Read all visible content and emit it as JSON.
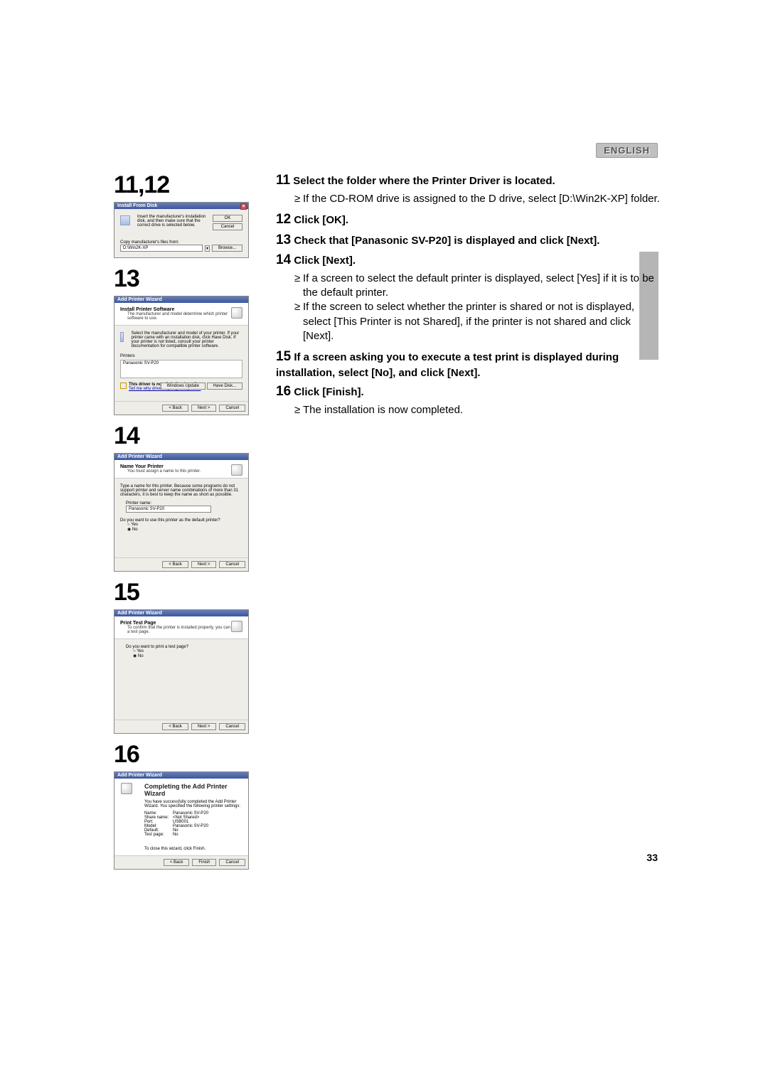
{
  "language_label": "ENGLISH",
  "page_number": "33",
  "left": {
    "heading_11_12": "11,12",
    "dlg_install_from_disk": {
      "title": "Install From Disk",
      "instruction": "Insert the manufacturer's installation disk, and then make sure that the correct drive is selected below.",
      "copy_label": "Copy manufacturer's files from:",
      "path_value": "D:\\Win2K-XP",
      "ok": "OK",
      "cancel": "Cancel",
      "browse": "Browse..."
    },
    "heading_13": "13",
    "dlg13": {
      "title": "Add Printer Wizard",
      "hdr_title": "Install Printer Software",
      "hdr_sub": "The manufacturer and model determine which printer software to use.",
      "body_text": "Select the manufacturer and model of your printer. If your printer came with an installation disk, click Have Disk. If your printer is not listed, consult your printer documentation for compatible printer software.",
      "printers_label": "Printers",
      "printer_item": "Panasonic SV-P20",
      "warn_bold": "This driver is not digitally signed!",
      "warn_link": "Tell me why driver signing is important",
      "win_update": "Windows Update",
      "have_disk": "Have Disk...",
      "back": "< Back",
      "next": "Next >",
      "cancel": "Cancel"
    },
    "heading_14": "14",
    "dlg14": {
      "title": "Add Printer Wizard",
      "hdr_title": "Name Your Printer",
      "hdr_sub": "You must assign a name to this printer.",
      "body_text": "Type a name for this printer. Because some programs do not support printer and server name combinations of more than 31 characters, it is best to keep the name as short as possible.",
      "name_label": "Printer name:",
      "name_value": "Panasonic SV-P20",
      "default_q": "Do you want to use this printer as the default printer?",
      "yes": "Yes",
      "no": "No",
      "back": "< Back",
      "next": "Next >",
      "cancel": "Cancel"
    },
    "heading_15": "15",
    "dlg15": {
      "title": "Add Printer Wizard",
      "hdr_title": "Print Test Page",
      "hdr_sub": "To confirm that the printer is installed properly, you can print a test page.",
      "q": "Do you want to print a test page?",
      "yes": "Yes",
      "no": "No",
      "back": "< Back",
      "next": "Next >",
      "cancel": "Cancel"
    },
    "heading_16": "16",
    "dlg16": {
      "title": "Add Printer Wizard",
      "complete_title": "Completing the Add Printer Wizard",
      "complete_sub": "You have successfully completed the Add Printer Wizard. You specified the following printer settings:",
      "kv": {
        "name_k": "Name:",
        "name_v": "Panasonic SV-P20",
        "share_k": "Share name:",
        "share_v": "<Not Shared>",
        "port_k": "Port:",
        "port_v": "USB001",
        "model_k": "Model:",
        "model_v": "Panasonic SV-P20",
        "default_k": "Default:",
        "default_v": "No",
        "test_k": "Test page:",
        "test_v": "No"
      },
      "close_hint": "To close this wizard, click Finish.",
      "back": "< Back",
      "finish": "Finish",
      "cancel": "Cancel"
    }
  },
  "steps": {
    "s11_num": "11",
    "s11_text": "Select the folder where the Printer Driver is located.",
    "s11_bullet": "If the CD-ROM drive is assigned to the D drive, select [D:\\Win2K-XP] folder.",
    "s12_num": "12",
    "s12_text": "Click [OK].",
    "s13_num": "13",
    "s13_text": "Check that [Panasonic SV-P20] is displayed and click [Next].",
    "s14_num": "14",
    "s14_text": "Click [Next].",
    "s14_bullet1": "If a screen to select the default printer is displayed, select [Yes] if it is to be the default printer.",
    "s14_bullet2": "If the screen to select whether the printer is shared or not is displayed, select [This Printer is not Shared], if the printer is not shared and click [Next].",
    "s15_num": "15",
    "s15_text": "If a screen asking you to execute a test print is displayed during installation, select [No], and click [Next].",
    "s16_num": "16",
    "s16_text": "Click [Finish].",
    "s16_bullet": "The installation is now completed."
  }
}
